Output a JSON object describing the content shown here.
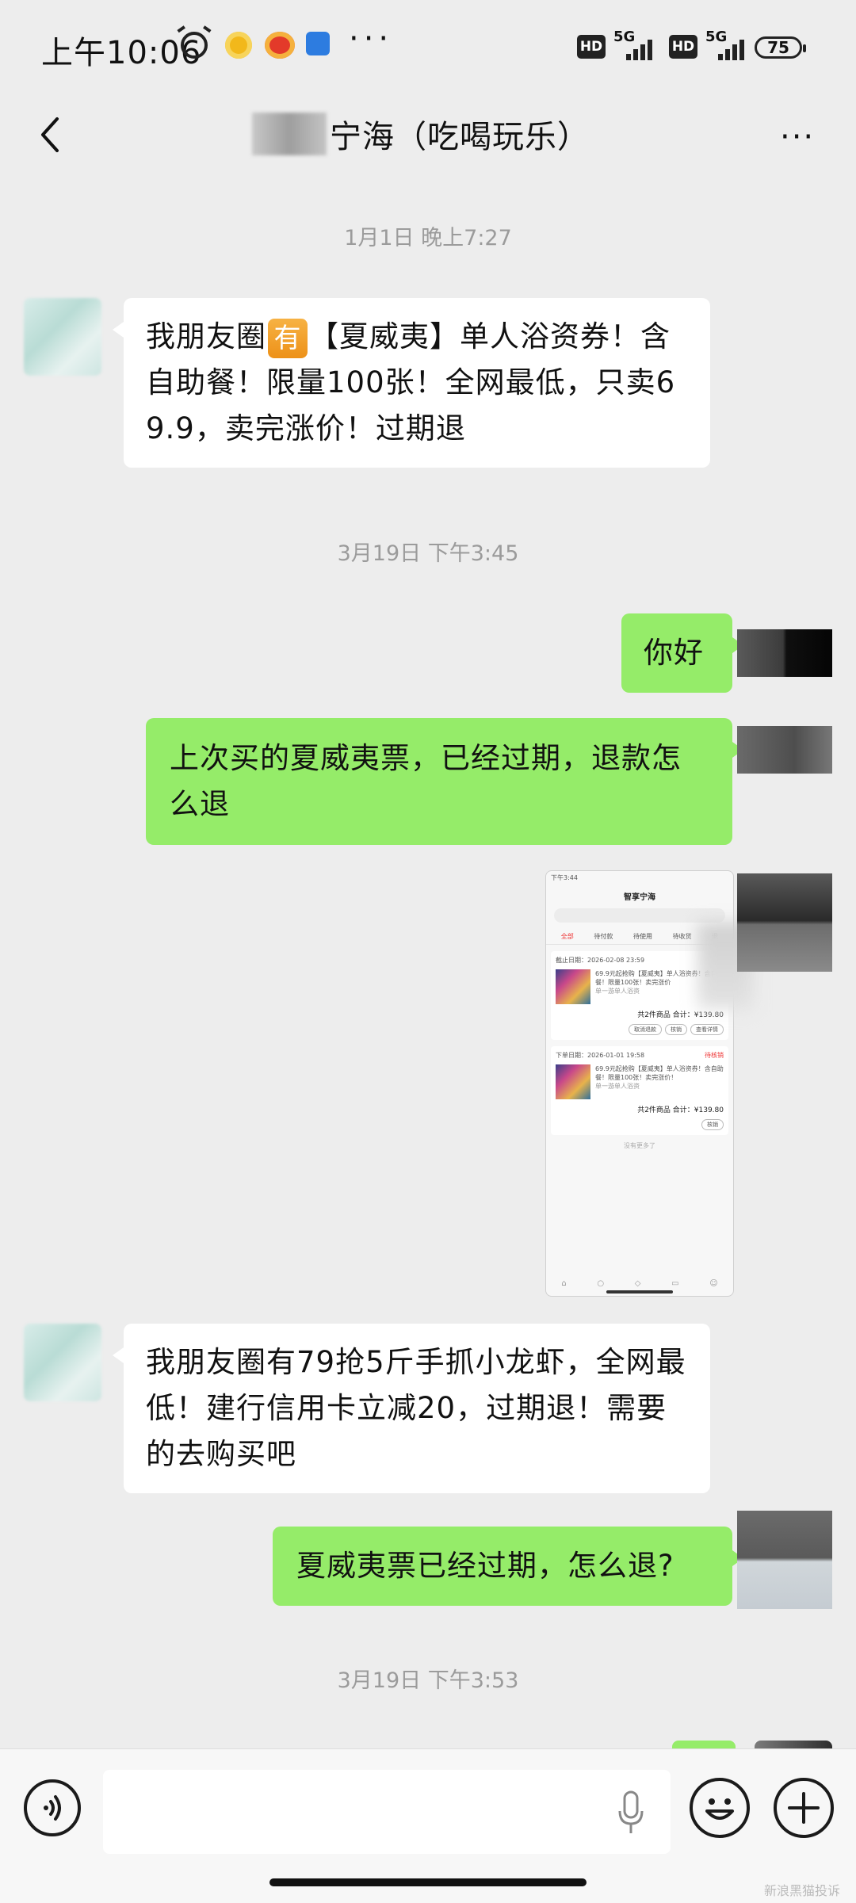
{
  "status": {
    "time": "上午10:06",
    "more": "···",
    "hd": "HD",
    "net": "5G",
    "battery": "75"
  },
  "header": {
    "title": "宁海（吃喝玩乐）",
    "more": "···"
  },
  "messages": {
    "ts1": "1月1日 晚上7:27",
    "m1_a": "我朋友圈",
    "m1_badge": "有",
    "m1_b": "【夏威夷】单人浴资券！含自助餐！限量100张！全网最低，只卖69.9，卖完涨价！过期退",
    "ts2": "3月19日 下午3:45",
    "m2": "你好",
    "m3": "上次买的夏威夷票，已经过期，退款怎么退",
    "m5": "我朋友圈有79抢5斤手抓小龙虾，全网最低！建行信用卡立减20，过期退！需要的去购买吧",
    "m6": "夏威夷票已经过期，怎么退?",
    "ts3": "3月19日 下午3:53"
  },
  "thumbnail": {
    "status": "下午3:44",
    "title": "智享宁海",
    "tabs": [
      "全部",
      "待付款",
      "待使用",
      "待收货",
      "退"
    ],
    "card1_date": "截止日期：2026-02-08 23:59",
    "card1_text": "69.9元起抢购【夏威夷】单人浴资券！含自助餐！限量100张！卖完涨价",
    "card1_sub": "单一游单人浴资",
    "card1_total": "共2件商品 合计：¥139.80",
    "card1_btns": [
      "取消退款",
      "核销",
      "查看详情"
    ],
    "card2_date": "下单日期：2026-01-01 19:58",
    "card2_status": "待核销",
    "card2_text": "69.9元起抢购【夏威夷】单人浴资券！含自助餐！限量100张！卖完涨价！",
    "card2_sub": "单一游单人浴资",
    "card2_total": "共2件商品 合计：¥139.80",
    "card2_btn": "核销",
    "end": "没有更多了"
  },
  "footer": {
    "watermark": "新浪黑猫投诉"
  }
}
